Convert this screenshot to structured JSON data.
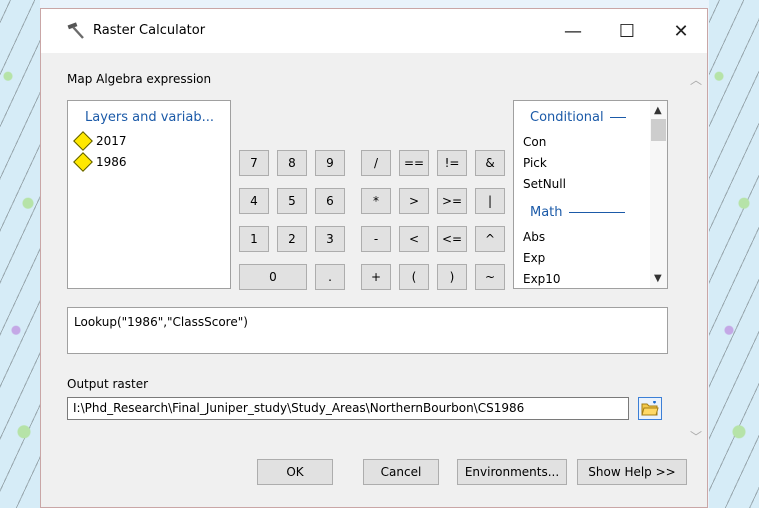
{
  "window": {
    "title": "Raster Calculator",
    "minimize": "—",
    "maximize": "☐",
    "close": "✕"
  },
  "expression_label": "Map Algebra expression",
  "layers": {
    "header": "Layers and variab...",
    "items": [
      "2017",
      "1986"
    ]
  },
  "keypad": {
    "row1": [
      "7",
      "8",
      "9",
      "/",
      "==",
      "!=",
      "&"
    ],
    "row2": [
      "4",
      "5",
      "6",
      "*",
      ">",
      ">=",
      "|"
    ],
    "row3": [
      "1",
      "2",
      "3",
      "-",
      "<",
      "<=",
      "^"
    ],
    "row4": [
      "0",
      ".",
      "+",
      "(",
      ")",
      "~"
    ]
  },
  "functions": {
    "groups": [
      {
        "name": "Conditional",
        "items": [
          "Con",
          "Pick",
          "SetNull"
        ]
      },
      {
        "name": "Math",
        "items": [
          "Abs",
          "Exp",
          "Exp10"
        ]
      }
    ]
  },
  "expression": "Lookup(\"1986\",\"ClassScore\")",
  "output": {
    "label": "Output raster",
    "value": "I:\\Phd_Research\\Final_Juniper_study\\Study_Areas\\NorthernBourbon\\CS1986"
  },
  "buttons": {
    "ok": "OK",
    "cancel": "Cancel",
    "environments": "Environments...",
    "help": "Show Help >>"
  }
}
